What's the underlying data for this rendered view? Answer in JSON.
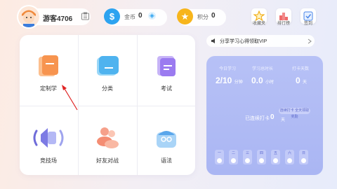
{
  "header": {
    "username": "游客4706",
    "coin_label": "金币",
    "coin_value": "0",
    "score_label": "积分",
    "score_value": "0",
    "buttons": [
      {
        "label": "收藏夹",
        "icon": "star-icon"
      },
      {
        "label": "排行榜",
        "icon": "ranking-icon"
      },
      {
        "label": "签到",
        "icon": "checkin-icon"
      }
    ]
  },
  "menu": [
    {
      "label": "定制学",
      "icon": "custom-study-icon"
    },
    {
      "label": "分类",
      "icon": "category-icon"
    },
    {
      "label": "考试",
      "icon": "exam-icon"
    },
    {
      "label": "竞技场",
      "icon": "arena-icon"
    },
    {
      "label": "好友对战",
      "icon": "friend-battle-icon"
    },
    {
      "label": "语法",
      "icon": "grammar-icon"
    }
  ],
  "notice": {
    "text": "分享学习心得领取VIP"
  },
  "stats": {
    "today_label": "今日学习",
    "today_value": "2/10",
    "today_unit": "分钟",
    "total_label": "学习总时长",
    "total_value": "0.0",
    "total_unit": "小时",
    "checkin_label": "打卡天数",
    "checkin_value": "0",
    "checkin_unit": "天",
    "badge": "连续打卡 全天领取奖励",
    "streak_label": "已连续打卡",
    "streak_value": "0",
    "streak_unit": "天",
    "days": [
      "一",
      "二",
      "三",
      "四",
      "五",
      "六",
      "日"
    ]
  },
  "colors": {
    "coin": "#2da3f0",
    "star": "#f7b51c",
    "panel": "#b0bbf4",
    "arrow": "#e02424"
  }
}
